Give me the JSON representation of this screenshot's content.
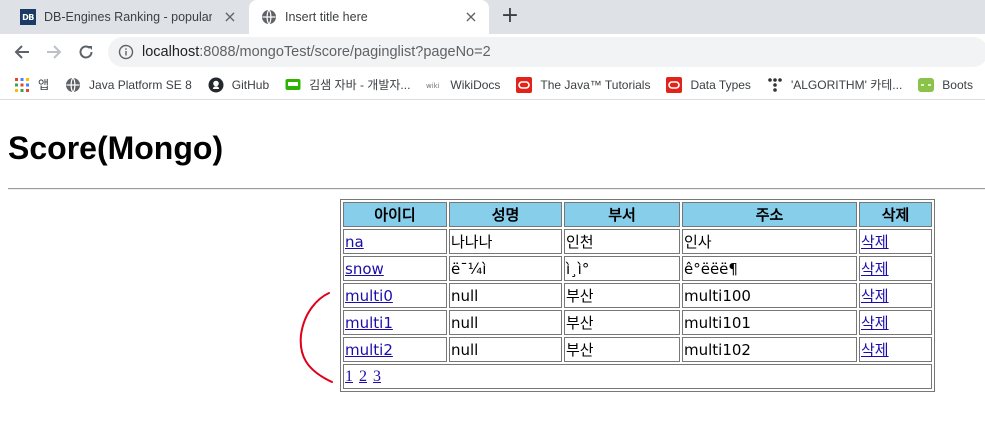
{
  "browser": {
    "tabs": [
      {
        "title": "DB-Engines Ranking - popularit",
        "favicon": "DB",
        "active": false
      },
      {
        "title": "Insert title here",
        "favicon": "globe-icon",
        "active": true
      }
    ],
    "url": {
      "host": "localhost",
      "rest": ":8088/mongoTest/score/paginglist?pageNo=2"
    },
    "bookmarks": [
      {
        "label": "앱",
        "icon": "apps-grid-icon"
      },
      {
        "label": "Java Platform SE 8",
        "icon": "globe-icon"
      },
      {
        "label": "GitHub",
        "icon": "github-icon"
      },
      {
        "label": "김샘 자바 - 개발자...",
        "icon": "blog-icon"
      },
      {
        "label": "WikiDocs",
        "icon": "wikidocs-icon"
      },
      {
        "label": "The Java™ Tutorials",
        "icon": "oracle-icon"
      },
      {
        "label": "Data Types",
        "icon": "oracle-icon"
      },
      {
        "label": "'ALGORITHM' 카테...",
        "icon": "tistory-icon"
      },
      {
        "label": "Boots",
        "icon": "bootstrap-icon"
      }
    ]
  },
  "page": {
    "title": "Score(Mongo)",
    "table": {
      "headers": [
        "아이디",
        "성명",
        "부서",
        "주소",
        "삭제"
      ],
      "rows": [
        {
          "id": "na",
          "name": "나나나",
          "dept": "인천",
          "addr": "인사",
          "del": "삭제"
        },
        {
          "id": "snow",
          "name": "ë¯¼ì ",
          "dept": "ì¸ì°",
          "addr": "ê°ëëë¶",
          "del": "삭제"
        },
        {
          "id": "multi0",
          "name": "null",
          "dept": "부산",
          "addr": "multi100",
          "del": "삭제"
        },
        {
          "id": "multi1",
          "name": "null",
          "dept": "부산",
          "addr": "multi101",
          "del": "삭제"
        },
        {
          "id": "multi2",
          "name": "null",
          "dept": "부산",
          "addr": "multi102",
          "del": "삭제"
        }
      ],
      "pages": [
        "1",
        "2",
        "3"
      ]
    }
  },
  "colors": {
    "header_bg": "#87ceeb",
    "link": "#1a0dab",
    "annotation": "#e0001a"
  }
}
